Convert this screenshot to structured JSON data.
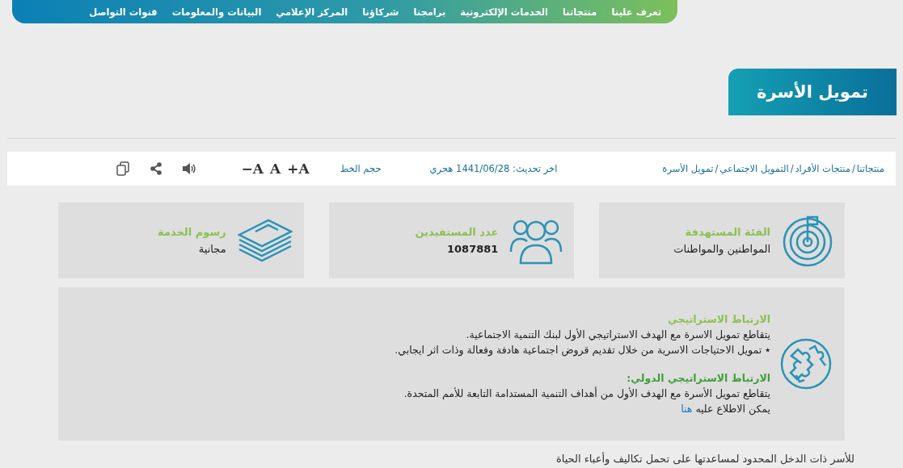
{
  "nav": {
    "items": [
      {
        "label": "تعرف علينا"
      },
      {
        "label": "منتجاتنا"
      },
      {
        "label": "الخدمات الإلكترونية"
      },
      {
        "label": "برامجنا"
      },
      {
        "label": "شركاؤنا"
      },
      {
        "label": "المركز الإعلامي"
      },
      {
        "label": "البيانات والمعلومات"
      },
      {
        "label": "قنوات التواصل"
      }
    ]
  },
  "page_title": "تمويل الأسرة",
  "breadcrumb": {
    "separator": "/",
    "items": [
      "منتجاتنا",
      "منتجات الأفراد",
      "التمويل الاجتماعي",
      "تمويل الأسرة"
    ]
  },
  "last_update": "اخر تحديث: 1441/06/28 هجري",
  "font_size": {
    "label": "حجم الخط",
    "buttons": [
      "+A",
      "A",
      "−A"
    ]
  },
  "cards": [
    {
      "kind": "target",
      "title": "الفئة المستهدفة",
      "value": "المواطنين والمواطنات",
      "bold": false
    },
    {
      "kind": "people",
      "title": "عدد المستفيدين",
      "value": "1087881",
      "bold": true
    },
    {
      "kind": "money",
      "title": "رسوم الخدمة",
      "value": "مجانية",
      "bold": false
    }
  ],
  "strategy": {
    "sections": [
      {
        "title": "الارتباط الاستراتيجي",
        "color": "#8cc152",
        "lines": [
          "يتقاطع تمويل الاسرة مع الهدف الاستراتيجي الأول لبنك التنمية الاجتماعية.",
          "٭ تمويل الاحتياجات الاسرية من خلال تقديم قروض اجتماعية هادفة وفعالة وذات اثر ايجابي."
        ]
      },
      {
        "title": "الارتباط الاستراتيجي الدولي:",
        "color": "#3f9e3a",
        "lines": [
          "يتقاطع تمويل الأسرة مع الهدف الأول من أهداف التنمية المستدامة التابعة للأمم المتحدة."
        ],
        "link_line": {
          "text": "يمكن الاطلاع عليه",
          "link": "هنا"
        }
      }
    ]
  },
  "footer_text": "للأسر ذات الدخل المحدود لمساعدتها على تحمل تكاليف وأعباء الحياة"
}
